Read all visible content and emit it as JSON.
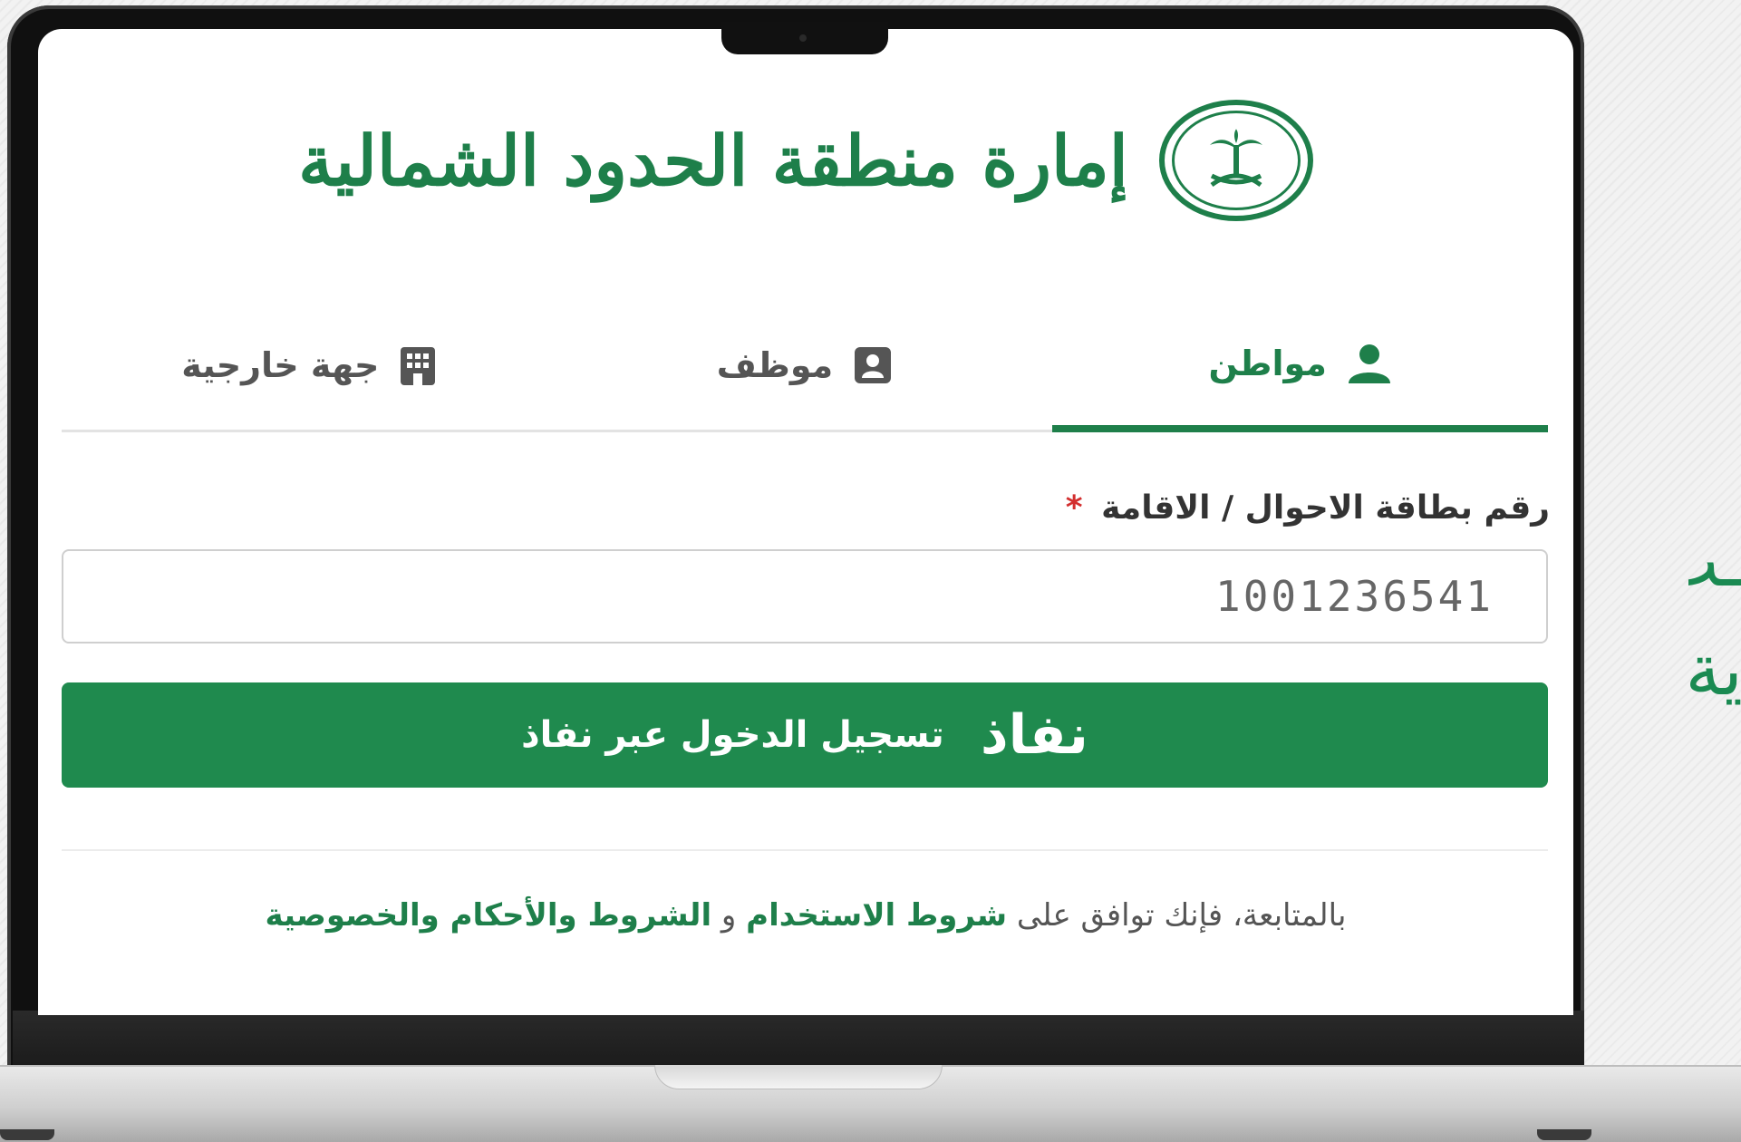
{
  "header": {
    "organization_name": "إمارة منطقة الحدود الشمالية",
    "emblem_icon": "saudi-emblem-palm-swords-icon"
  },
  "tabs": [
    {
      "label": "مواطن",
      "icon": "user-icon",
      "active": true
    },
    {
      "label": "موظف",
      "icon": "id-badge-icon",
      "active": false
    },
    {
      "label": "جهة خارجية",
      "icon": "building-icon",
      "active": false
    }
  ],
  "form": {
    "id_label": "رقم بطاقة الاحوال / الاقامة",
    "required_mark": "*",
    "id_value": "1001236541"
  },
  "login_button": {
    "provider_logo_text": "نفاذ",
    "label": "تسجيل الدخول عبر نفاذ"
  },
  "terms": {
    "prefix": "بالمتابعة، فإنك توافق على",
    "terms_of_use": "شروط الاستخدام",
    "conjunction": "و",
    "privacy": "الشروط والأحكام والخصوصية"
  },
  "side_text": {
    "line1": "ـب",
    "line2": "ية."
  },
  "colors": {
    "brand_green": "#1f8a4e",
    "required_red": "#d32f2f"
  }
}
